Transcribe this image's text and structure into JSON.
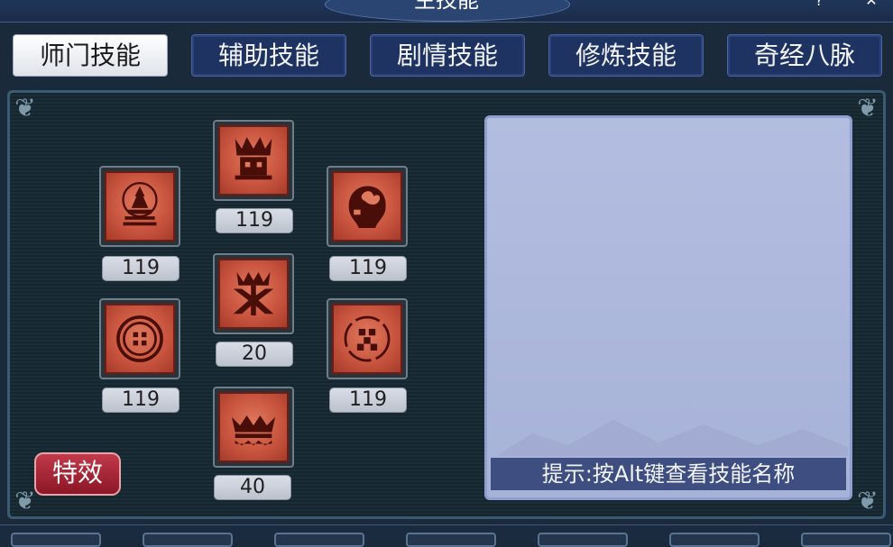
{
  "window": {
    "title": "主技能"
  },
  "tabs": [
    {
      "label": "师门技能",
      "active": true
    },
    {
      "label": "辅助技能",
      "active": false
    },
    {
      "label": "剧情技能",
      "active": false
    },
    {
      "label": "修炼技能",
      "active": false
    },
    {
      "label": "奇经八脉",
      "active": false
    }
  ],
  "skills": [
    {
      "icon": "pagoda-icon",
      "level": "119"
    },
    {
      "icon": "warrior-head-icon",
      "level": "119"
    },
    {
      "icon": "skull-bird-icon",
      "level": "119"
    },
    {
      "icon": "totem-icon",
      "level": "20"
    },
    {
      "icon": "round-seal-icon",
      "level": "119"
    },
    {
      "icon": "dice-circle-icon",
      "level": "119"
    },
    {
      "icon": "crown-icon",
      "level": "40"
    }
  ],
  "effect_button": "特效",
  "hint": "提示:按Alt键查看技能名称",
  "colors": {
    "tab_active": "#ffffff",
    "tab_inactive": "#1f3363",
    "skill_face": "#c9553f",
    "effect_button": "#a82234",
    "info_panel": "#b3bde0",
    "hint_bar": "#3e4e80"
  }
}
